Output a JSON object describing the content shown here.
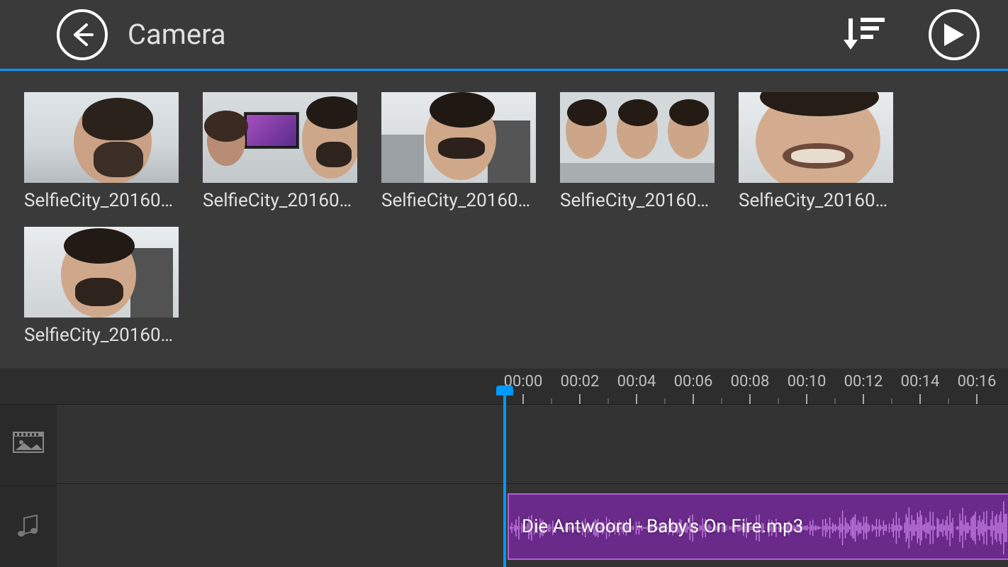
{
  "header": {
    "title": "Camera"
  },
  "grid": {
    "items": [
      {
        "label": "SelfieCity_20160…"
      },
      {
        "label": "SelfieCity_20160…"
      },
      {
        "label": "SelfieCity_20160…"
      },
      {
        "label": "SelfieCity_20160…"
      },
      {
        "label": "SelfieCity_20160…"
      },
      {
        "label": "SelfieCity_20160…"
      }
    ]
  },
  "timeline": {
    "ticks": [
      "00:00",
      "00:02",
      "00:04",
      "00:06",
      "00:08",
      "00:10",
      "00:12",
      "00:14",
      "00:16"
    ],
    "tick_spacing_px": 80,
    "audio_clip_label": "Die Antwoord - Baby's On Fire.mp3"
  }
}
